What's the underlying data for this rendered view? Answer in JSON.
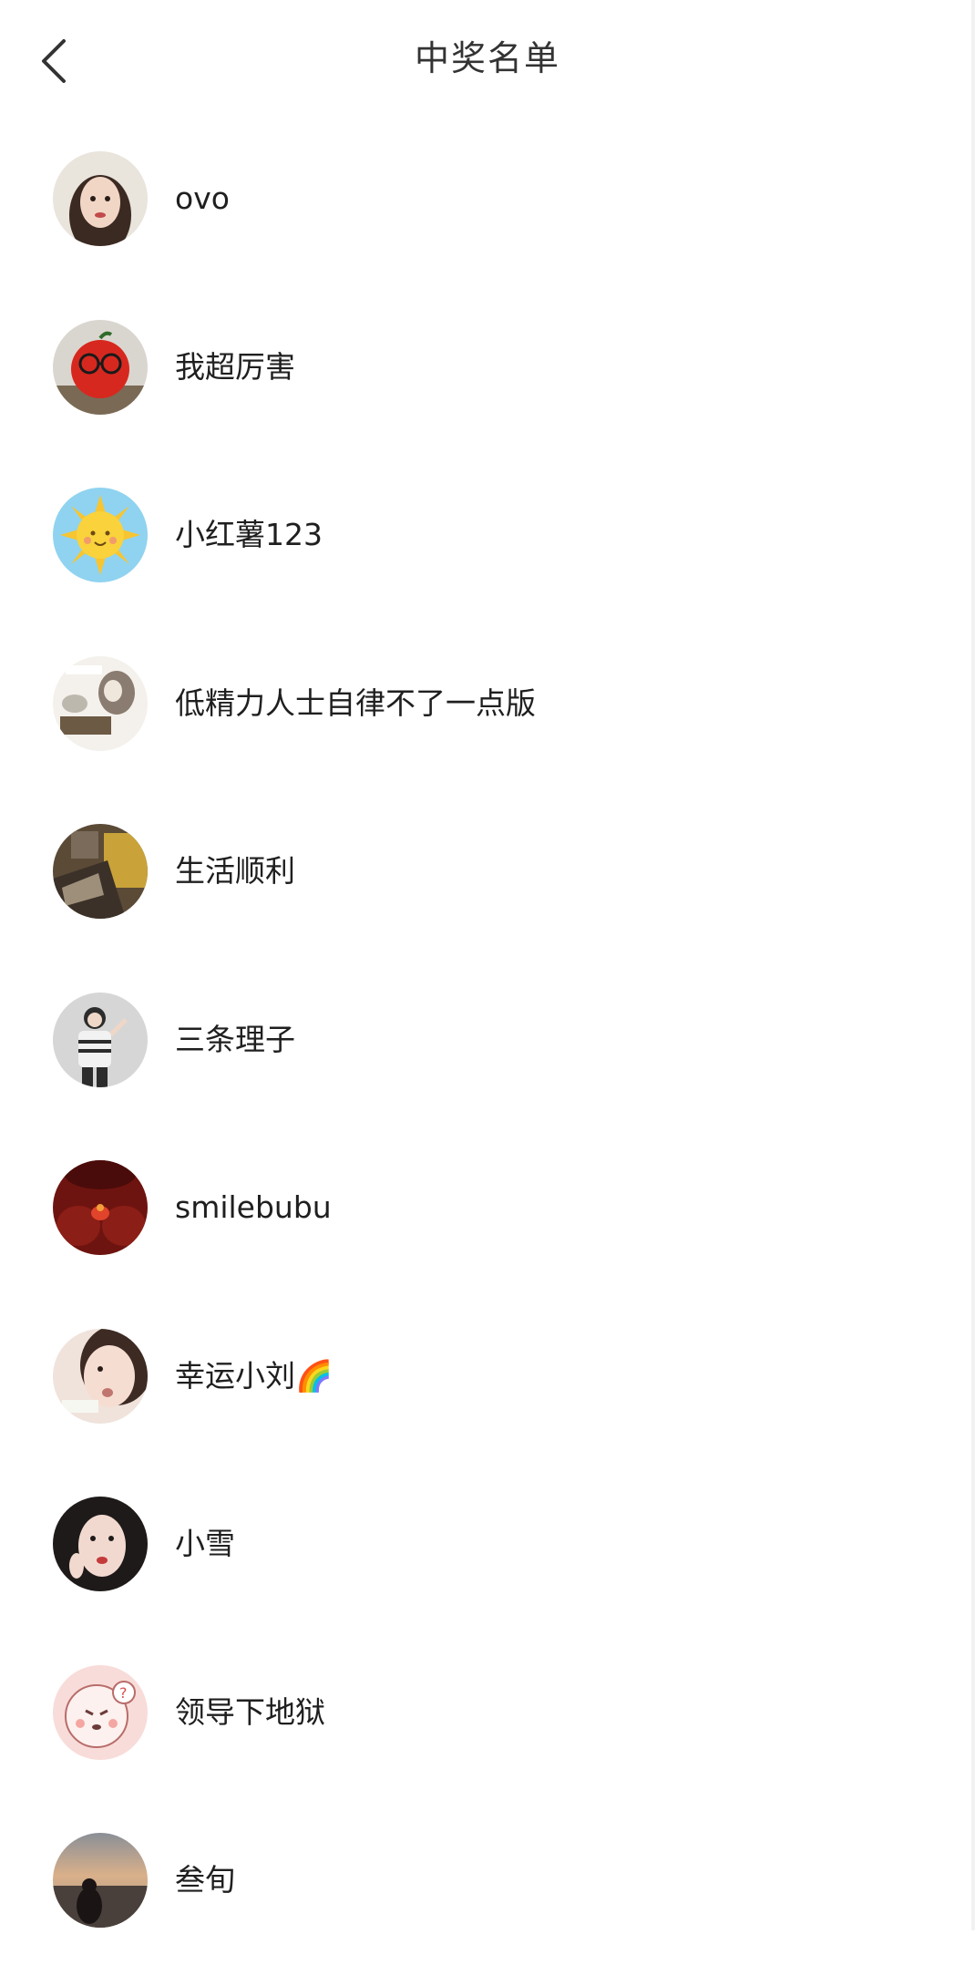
{
  "header": {
    "title": "中奖名单",
    "back_icon": "chevron-left-icon"
  },
  "winners": [
    {
      "name": "ovo",
      "avatar": "avatar-photo-girl",
      "avatar_colors": [
        "#e9e4dc",
        "#3b2a22"
      ]
    },
    {
      "name": "我超厉害",
      "avatar": "avatar-red-tomato-with-glasses",
      "avatar_colors": [
        "#d9d6cf",
        "#d7281f"
      ]
    },
    {
      "name": "小红薯123",
      "avatar": "avatar-cartoon-sun",
      "avatar_colors": [
        "#8fd3f0",
        "#f7c531"
      ]
    },
    {
      "name": "低精力人士自律不了一点版",
      "avatar": "avatar-cat-meme",
      "avatar_colors": [
        "#f4f1ec",
        "#8a7c70"
      ]
    },
    {
      "name": "生活顺利",
      "avatar": "avatar-dark-scene",
      "avatar_colors": [
        "#5a4a36",
        "#c9a33a"
      ]
    },
    {
      "name": "三条理子",
      "avatar": "avatar-photo-person-striped",
      "avatar_colors": [
        "#d6d6d6",
        "#2c2c2c"
      ]
    },
    {
      "name": "smilebubu",
      "avatar": "avatar-red-scene",
      "avatar_colors": [
        "#6e1410",
        "#e0442a"
      ]
    },
    {
      "name": "幸运小刘🌈",
      "avatar": "avatar-photo-girl-closeup",
      "avatar_colors": [
        "#efe3dc",
        "#c0766e"
      ]
    },
    {
      "name": "小雪",
      "avatar": "avatar-photo-girl-dark-hair",
      "avatar_colors": [
        "#1e1a19",
        "#f2d9cf"
      ]
    },
    {
      "name": "领导下地狱",
      "avatar": "avatar-cartoon-pink-face",
      "avatar_colors": [
        "#f8dcd9",
        "#b86d6a"
      ]
    },
    {
      "name": "叁旬",
      "avatar": "avatar-sunset-silhouette",
      "avatar_colors": [
        "#c9a788",
        "#2a2320"
      ]
    }
  ]
}
